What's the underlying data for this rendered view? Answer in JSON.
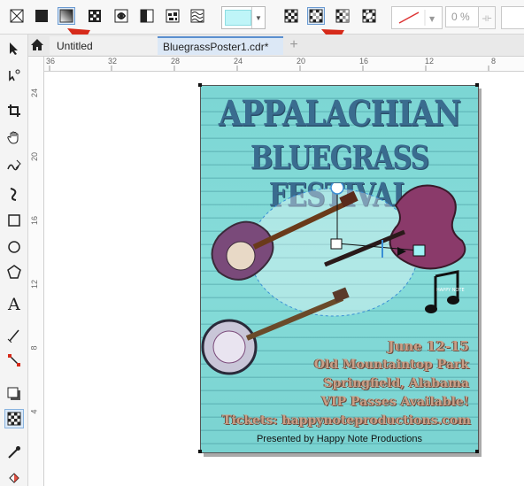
{
  "tabs": [
    {
      "label": "Untitled",
      "active": false
    },
    {
      "label": "BluegrassPoster1.cdr*",
      "active": true
    }
  ],
  "property_bar": {
    "fill_types": [
      "no-fill-icon",
      "uniform-fill-icon",
      "fountain-fill-icon",
      "vector-pattern-icon",
      "bitmap-pattern-icon",
      "two-color-pattern-icon",
      "texture-fill-icon",
      "postscript-fill-icon"
    ],
    "selected_fill": "fountain-fill-icon",
    "color_swatch": "#bff5f8",
    "transparency_percent": "0 %",
    "transparency_modes": [
      "transparency-mode-1-icon",
      "transparency-mode-2-icon",
      "transparency-mode-3-icon",
      "transparency-mode-4-icon"
    ],
    "selected_transparency": "transparency-mode-2-icon"
  },
  "ruler": {
    "h_ticks": [
      "36",
      "32",
      "28",
      "24",
      "20",
      "16",
      "12",
      "8"
    ],
    "v_ticks": [
      "24",
      "20",
      "16",
      "12",
      "8",
      "4"
    ]
  },
  "poster": {
    "title_line1": "APPALACHIAN",
    "title_line2": "BLUEGRASS FESTIVAL",
    "date": "June 12-15",
    "venue": "Old Mountaintop Park",
    "city": "Springfield, Alabama",
    "vip": "VIP Passes Available!",
    "tickets": "Tickets: happynoteproductions.com",
    "presented": "Presented by Happy Note Productions",
    "logo_text": "HAPPY NOTE",
    "background_color": "#7fd8d6",
    "title_color": "#3a6c8f",
    "text_color": "#c9a088"
  },
  "annotations": {
    "arrow_color": "#d62a1a"
  }
}
